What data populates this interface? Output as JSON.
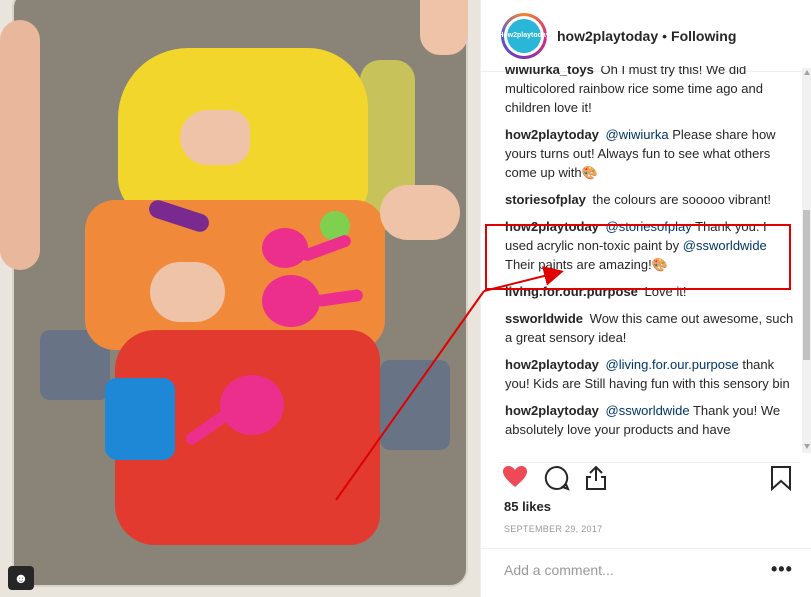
{
  "header": {
    "username": "how2playtoday",
    "separator": "•",
    "follow_status": "Following",
    "avatar_text": "How2playtoday"
  },
  "comments": [
    {
      "user": "wiwiurka_toys",
      "mention": "",
      "text": "Oh I must try this! We did multicolored rainbow rice some time ago and children love it!"
    },
    {
      "user": "how2playtoday",
      "mention": "@wiwiurka",
      "text": "Please share how yours turns out! Always fun to see what others come up with🎨"
    },
    {
      "user": "storiesofplay",
      "mention": "",
      "text": "the colours are sooooo vibrant!"
    },
    {
      "user": "how2playtoday",
      "mention": "@storiesofplay",
      "text": "Thank you. I used acrylic non-toxic paint by",
      "mention2": "@ssworldwide",
      "text2": "Their paints are amazing!🎨"
    },
    {
      "user": "living.for.our.purpose",
      "mention": "",
      "text": "Love it!"
    },
    {
      "user": "ssworldwide",
      "mention": "",
      "text": "Wow this came out awesome, such a great sensory idea!"
    },
    {
      "user": "how2playtoday",
      "mention": "@living.for.our.purpose",
      "text": "thank you! Kids are Still having fun with this sensory bin"
    },
    {
      "user": "how2playtoday",
      "mention": "@ssworldwide",
      "text": "Thank you! We absolutely love your products and have"
    }
  ],
  "actions": {
    "like_icon": "heart-icon",
    "comment_icon": "comment-bubble-icon",
    "share_icon": "share-icon",
    "save_icon": "bookmark-icon"
  },
  "likes": "85 likes",
  "date": "SEPTEMBER 29, 2017",
  "add_comment": {
    "placeholder": "Add a comment..."
  },
  "more_options": "•••",
  "colors": {
    "like_red": "#ed4956",
    "highlight_red": "#e00000",
    "mention_blue": "#003569"
  }
}
